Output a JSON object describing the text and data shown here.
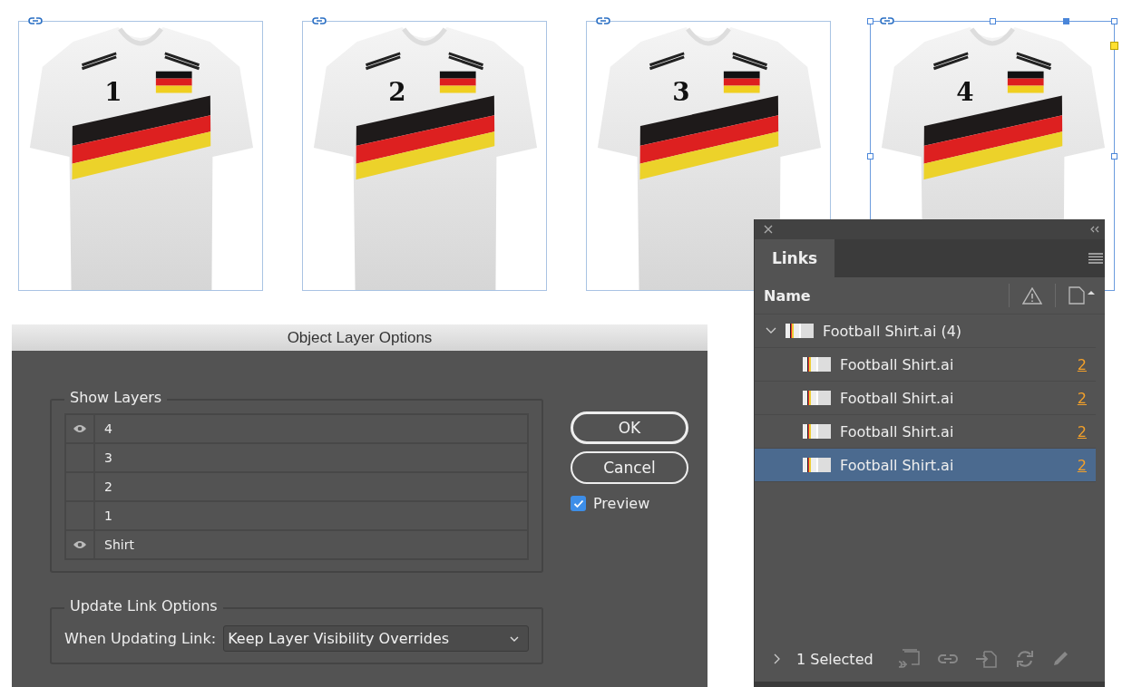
{
  "frames": [
    {
      "number": "1",
      "selected": false
    },
    {
      "number": "2",
      "selected": false
    },
    {
      "number": "3",
      "selected": false
    },
    {
      "number": "4",
      "selected": true
    }
  ],
  "dialog": {
    "title": "Object Layer Options",
    "show_layers": {
      "legend": "Show Layers",
      "layers": [
        {
          "name": "4",
          "visible": true
        },
        {
          "name": "3",
          "visible": false
        },
        {
          "name": "2",
          "visible": false
        },
        {
          "name": "1",
          "visible": false
        },
        {
          "name": "Shirt",
          "visible": true
        }
      ]
    },
    "update_link_options": {
      "legend": "Update Link Options",
      "label": "When Updating Link:",
      "value": "Keep Layer Visibility Overrides"
    },
    "buttons": [
      {
        "label": "OK",
        "default": true
      },
      {
        "label": "Cancel",
        "default": false
      }
    ],
    "preview": {
      "label": "Preview",
      "checked": true
    }
  },
  "links_panel": {
    "tab": "Links",
    "column": "Name",
    "group": {
      "name": "Football Shirt.ai (4)",
      "expanded": true,
      "children": [
        {
          "name": "Football Shirt.ai",
          "page": "2",
          "selected": false
        },
        {
          "name": "Football Shirt.ai",
          "page": "2",
          "selected": false
        },
        {
          "name": "Football Shirt.ai",
          "page": "2",
          "selected": false
        },
        {
          "name": "Football Shirt.ai",
          "page": "2",
          "selected": true
        }
      ]
    },
    "status": "1 Selected"
  }
}
